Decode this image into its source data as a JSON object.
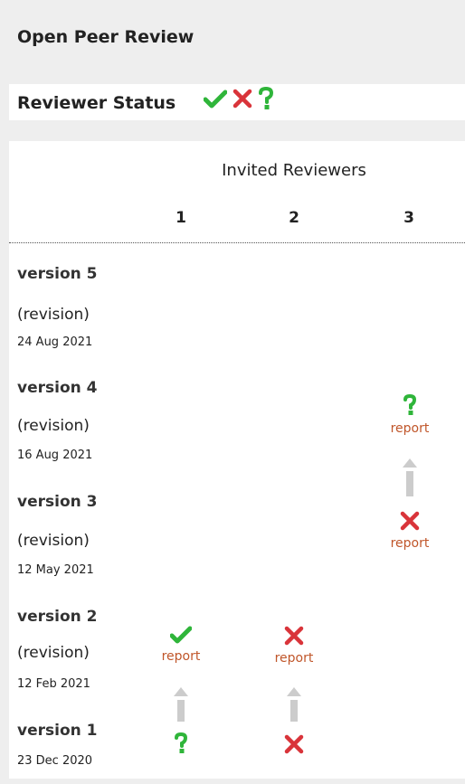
{
  "header": {
    "title": "Open Peer Review"
  },
  "status": {
    "label": "Reviewer Status"
  },
  "table": {
    "invited_label": "Invited Reviewers",
    "columns": [
      "1",
      "2",
      "3"
    ]
  },
  "versions": [
    {
      "label": "version 5",
      "revision": "(revision)",
      "date": "24 Aug 2021"
    },
    {
      "label": "version 4",
      "revision": "(revision)",
      "date": "16 Aug 2021"
    },
    {
      "label": "version 3",
      "revision": "(revision)",
      "date": "12 May 2021"
    },
    {
      "label": "version 2",
      "revision": "(revision)",
      "date": "12 Feb 2021"
    },
    {
      "label": "version 1",
      "date": "23 Dec 2020"
    }
  ],
  "reports": {
    "v4_r3": {
      "status": "question-icon",
      "link": "report"
    },
    "v3_r3": {
      "status": "cross-icon",
      "link": "report"
    },
    "v2_r1": {
      "status": "check-icon",
      "link": "report"
    },
    "v2_r2": {
      "status": "cross-icon",
      "link": "report"
    },
    "v1_r1": {
      "status": "question-icon"
    },
    "v1_r2": {
      "status": "cross-icon"
    }
  },
  "colors": {
    "approved": "#2fb53a",
    "not_approved": "#d9343a",
    "reservations": "#2fb53a",
    "report_link": "#c0562a"
  }
}
